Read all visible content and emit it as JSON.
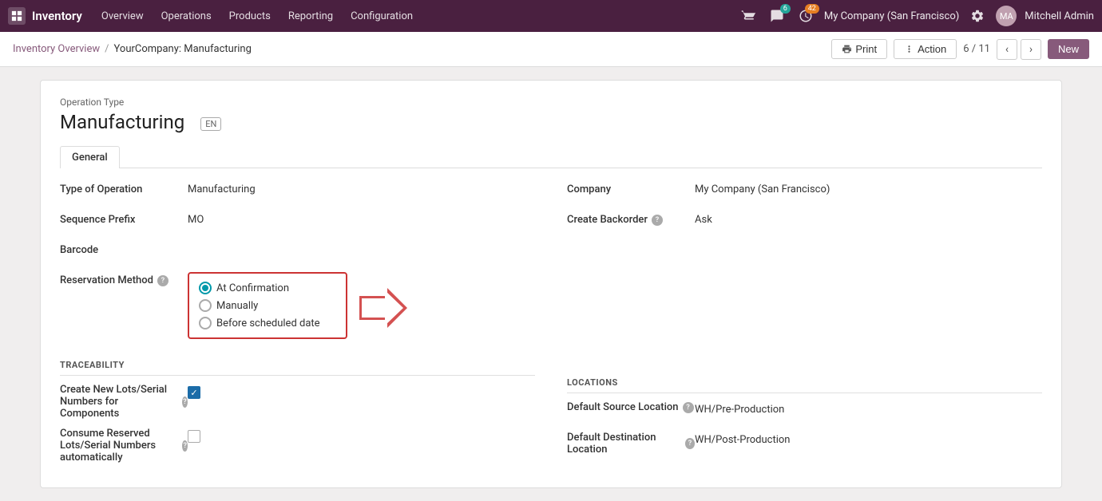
{
  "topnav": {
    "app_name": "Inventory",
    "menu_items": [
      "Overview",
      "Operations",
      "Products",
      "Reporting",
      "Configuration"
    ],
    "chat_badge": "6",
    "clock_badge": "42",
    "company": "My Company (San Francisco)",
    "user": "Mitchell Admin"
  },
  "breadcrumb": {
    "parent": "Inventory Overview",
    "separator": "/",
    "current": "YourCompany: Manufacturing",
    "print_label": "Print",
    "action_label": "Action",
    "page_info": "6 / 11",
    "new_label": "New"
  },
  "form": {
    "operation_type_label": "Operation Type",
    "title": "Manufacturing",
    "lang": "EN",
    "tabs": [
      "General"
    ],
    "active_tab": "General",
    "fields": {
      "type_of_operation_label": "Type of Operation",
      "type_of_operation_value": "Manufacturing",
      "sequence_prefix_label": "Sequence Prefix",
      "sequence_prefix_value": "MO",
      "barcode_label": "Barcode",
      "reservation_method_label": "Reservation Method",
      "company_label": "Company",
      "company_value": "My Company (San Francisco)",
      "create_backorder_label": "Create Backorder",
      "create_backorder_value": "Ask"
    },
    "reservation_options": [
      "At Confirmation",
      "Manually",
      "Before scheduled date"
    ],
    "reservation_selected": "At Confirmation",
    "traceability": {
      "header": "TRACEABILITY",
      "create_lots_label": "Create New Lots/Serial Numbers for Components",
      "create_lots_checked": true,
      "consume_label": "Consume Reserved Lots/Serial Numbers automatically",
      "consume_checked": false
    },
    "locations": {
      "header": "LOCATIONS",
      "default_source_label": "Default Source Location",
      "default_source_value": "WH/Pre-Production",
      "default_dest_label": "Default Destination Location",
      "default_dest_value": "WH/Post-Production"
    }
  }
}
